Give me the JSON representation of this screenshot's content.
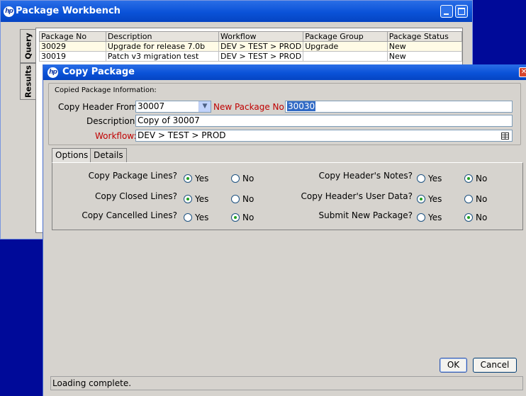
{
  "workbench": {
    "title": "Package Workbench",
    "side_tabs": {
      "query": "Query",
      "results": "Results"
    },
    "columns": [
      "Package No",
      "Description",
      "Workflow",
      "Package Group",
      "Package Status"
    ],
    "rows": [
      [
        "30029",
        "Upgrade for release 7.0b",
        "DEV > TEST > PROD",
        "Upgrade",
        "New"
      ],
      [
        "30019",
        "Patch v3 migration test",
        "DEV > TEST > PROD",
        "",
        "New"
      ]
    ]
  },
  "dialog": {
    "title": "Copy Package",
    "group_label": "Copied Package Information:",
    "copy_header_from_label": "Copy Header From:",
    "copy_header_from_value": "30007",
    "new_package_no_label": "New Package No:",
    "new_package_no_value": "30030",
    "description_label": "Description:",
    "description_value": "Copy of 30007",
    "workflow_label": "Workflow:",
    "workflow_value": "DEV > TEST > PROD",
    "tabs": {
      "options": "Options",
      "details": "Details"
    },
    "options": {
      "copy_package_lines": {
        "label": "Copy Package Lines?",
        "selected": "Yes"
      },
      "copy_closed_lines": {
        "label": "Copy Closed Lines?",
        "selected": "Yes"
      },
      "copy_cancelled_lines": {
        "label": "Copy Cancelled Lines?",
        "selected": "No"
      },
      "copy_header_notes": {
        "label": "Copy Header's Notes?",
        "selected": "No"
      },
      "copy_header_user_data": {
        "label": "Copy Header's User Data?",
        "selected": "Yes"
      },
      "submit_new_package": {
        "label": "Submit New Package?",
        "selected": "No"
      }
    },
    "yes_label": "Yes",
    "no_label": "No",
    "ok_label": "OK",
    "cancel_label": "Cancel",
    "status": "Loading complete."
  },
  "colors": {
    "desktop": "#000a99",
    "titlebar": "#0a52d8",
    "required_label": "#c00000",
    "selection": "#316ac5"
  }
}
